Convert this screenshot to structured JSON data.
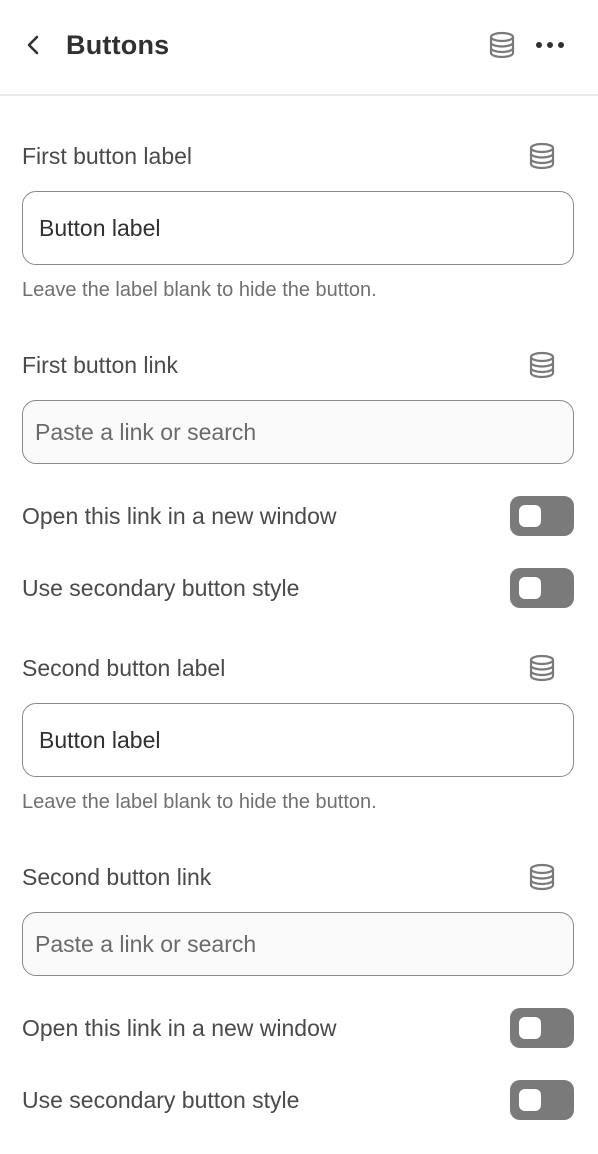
{
  "header": {
    "title": "Buttons",
    "back_icon": "chevron-left-icon",
    "data_source_icon": "database-icon",
    "more_icon": "more-horizontal-icon"
  },
  "first_button": {
    "label_heading": "First button label",
    "label_value": "Button label",
    "label_help": "Leave the label blank to hide the button.",
    "link_heading": "First button link",
    "link_placeholder": "Paste a link or search",
    "new_window_label": "Open this link in a new window",
    "new_window_on": false,
    "secondary_label": "Use secondary button style",
    "secondary_on": false
  },
  "second_button": {
    "label_heading": "Second button label",
    "label_value": "Button label",
    "label_help": "Leave the label blank to hide the button.",
    "link_heading": "Second button link",
    "link_placeholder": "Paste a link or search",
    "new_window_label": "Open this link in a new window",
    "new_window_on": false,
    "secondary_label": "Use secondary button style",
    "secondary_on": false
  },
  "colors": {
    "toggle_off": "#7a7a7a",
    "border": "#8a8a8a",
    "text": "#303030",
    "help_text": "#707070"
  }
}
